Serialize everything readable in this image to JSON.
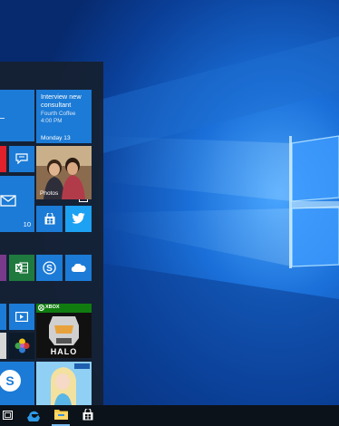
{
  "start_menu": {
    "calendar_tile": {
      "event_title": "Interview new consultant",
      "event_location": "Fourth Coffee",
      "event_time": "4:00 PM",
      "date_label": "Monday 13"
    },
    "photos_tile": {
      "label": "Photos"
    },
    "mail_tile": {
      "unread_count": "10"
    },
    "xbox_tile": {
      "label": "XBOX"
    }
  },
  "taskbar": {
    "items": [
      "task-view",
      "edge",
      "file-explorer",
      "store"
    ]
  },
  "colors": {
    "tile_blue": "#1c7bd6",
    "tile_red": "#e0202a",
    "excel_green": "#1f7a3f",
    "xbox_green": "#107c10",
    "taskbar": "#0c1219",
    "active_indicator": "#76b9ed"
  }
}
